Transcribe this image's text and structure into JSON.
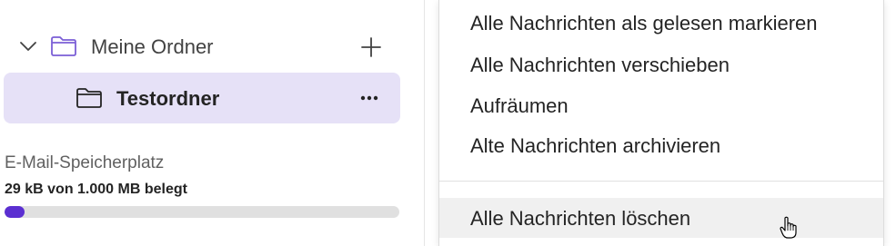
{
  "folders": {
    "parent": {
      "label": "Meine Ordner",
      "icon": "folder-icon",
      "expand_icon": "chevron-down-icon",
      "add_icon": "plus-icon"
    },
    "selected": {
      "label": "Testordner",
      "icon": "folder-icon",
      "more_icon": "more-horizontal-icon"
    }
  },
  "storage": {
    "title": "E-Mail-Speicherplatz",
    "used_text": "29 kB von 1.000 MB belegt",
    "used_fraction": 0.05,
    "bar_color": "#5b2fd1",
    "track_color": "#e0e0e0"
  },
  "context_menu": {
    "items": [
      {
        "label": "Alle Nachrichten als gelesen markieren"
      },
      {
        "label": "Alle Nachrichten verschieben"
      },
      {
        "label": "Aufräumen"
      },
      {
        "label": "Alte Nachrichten archivieren"
      },
      {
        "label": "Alle Nachrichten löschen",
        "hovered": true
      }
    ]
  },
  "colors": {
    "selected_row_bg": "#e6e1f7",
    "folder_icon_accent": "#7b5fd6",
    "hover_bg": "#f0f0f0"
  },
  "cursor": {
    "icon": "hand-pointer-icon"
  }
}
